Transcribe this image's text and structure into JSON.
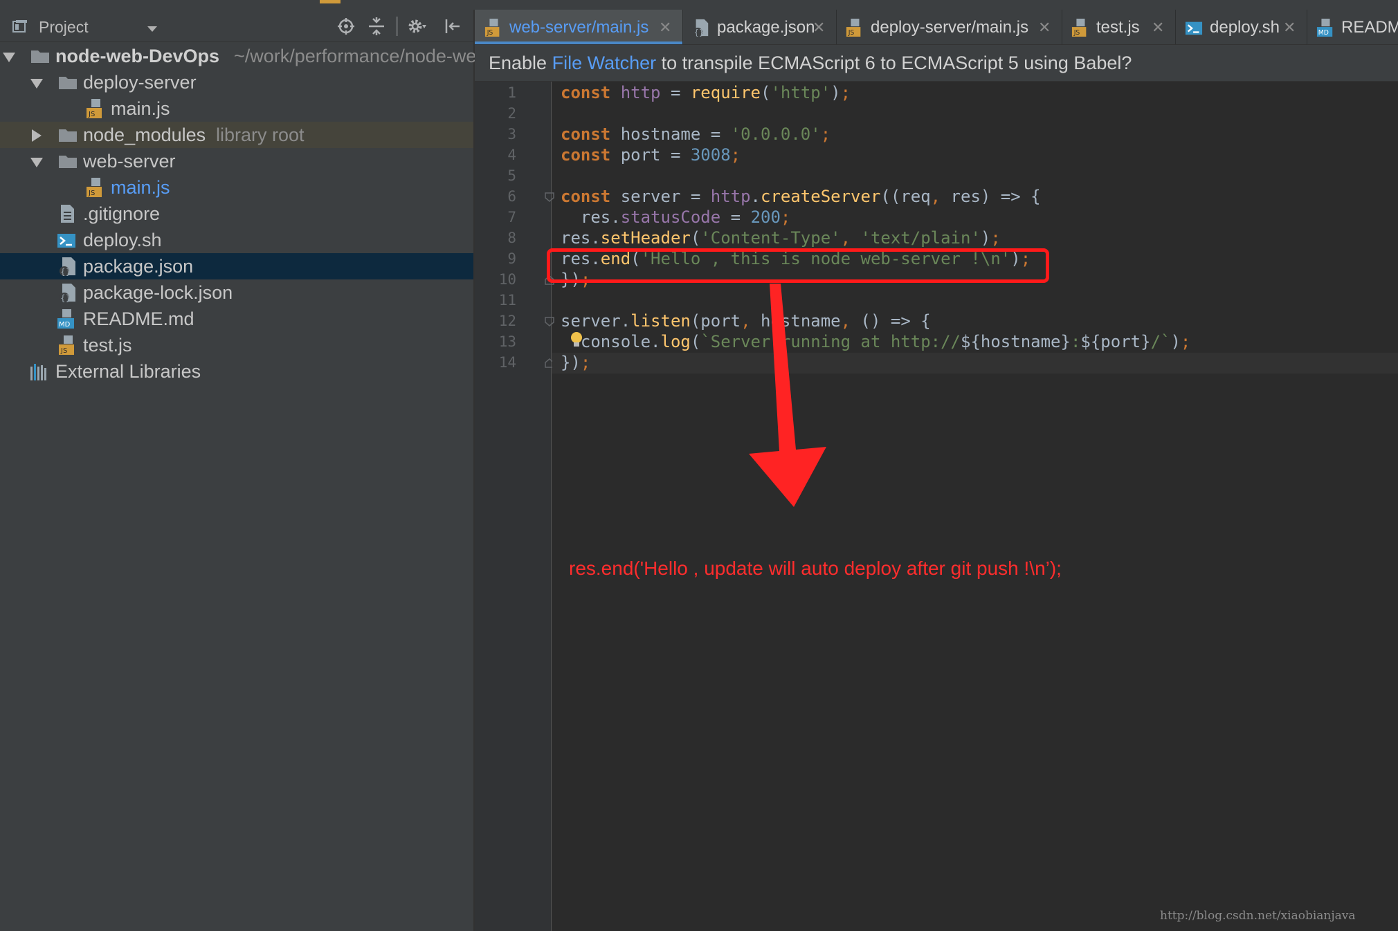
{
  "colors": {
    "editor_bg": "#2b2b2b",
    "panel_bg": "#3c3f41",
    "keyword": "#cc7832",
    "function": "#ffc66d",
    "string": "#6a8759",
    "number": "#6897bb",
    "property": "#9876aa",
    "link": "#589df6",
    "annotation": "#ff2d2d",
    "selection": "#0d293e"
  },
  "project_panel": {
    "title": "Project",
    "toolbar_icons": [
      "locate-icon",
      "collapse-all-icon",
      "gear-icon",
      "hide-panel-icon"
    ],
    "tree": [
      {
        "label": "node-web-DevOps",
        "path": "~/work/performance/node-web-DevOps",
        "type": "folder",
        "expanded": true,
        "bold": true
      },
      {
        "label": "deploy-server",
        "type": "folder",
        "expanded": true
      },
      {
        "label": "main.js",
        "type": "js"
      },
      {
        "label": "node_modules",
        "note": "library root",
        "type": "folder",
        "expanded": false
      },
      {
        "label": "web-server",
        "type": "folder",
        "expanded": true
      },
      {
        "label": "main.js",
        "type": "js",
        "active": true
      },
      {
        "label": ".gitignore",
        "type": "text"
      },
      {
        "label": "deploy.sh",
        "type": "shell"
      },
      {
        "label": "package.json",
        "type": "json",
        "selected": true
      },
      {
        "label": "package-lock.json",
        "type": "json"
      },
      {
        "label": "README.md",
        "type": "md"
      },
      {
        "label": "test.js",
        "type": "js"
      },
      {
        "label": "External Libraries",
        "type": "libraries"
      }
    ]
  },
  "tabs": [
    {
      "label": "web-server/main.js",
      "icon": "js-file-icon",
      "active": true
    },
    {
      "label": "package.json",
      "icon": "json-file-icon"
    },
    {
      "label": "deploy-server/main.js",
      "icon": "js-file-icon"
    },
    {
      "label": "test.js",
      "icon": "js-file-icon"
    },
    {
      "label": "deploy.sh",
      "icon": "shell-file-icon"
    },
    {
      "label": "README.md",
      "icon": "md-file-icon"
    }
  ],
  "notification": {
    "prefix": "Enable ",
    "link": "File Watcher",
    "suffix": " to transpile ECMAScript 6 to ECMAScript 5 using Babel?"
  },
  "editor": {
    "current_line": 14,
    "lines": [
      [
        [
          "kw",
          "const "
        ],
        [
          "prop",
          "http"
        ],
        [
          "plain",
          " = "
        ],
        [
          "fn",
          "require"
        ],
        [
          "plain",
          "("
        ],
        [
          "str",
          "'http'"
        ],
        [
          "plain",
          ")"
        ],
        [
          "punc",
          ";"
        ]
      ],
      [],
      [
        [
          "kw",
          "const "
        ],
        [
          "plain",
          "hostname = "
        ],
        [
          "str",
          "'0.0.0.0'"
        ],
        [
          "punc",
          ";"
        ]
      ],
      [
        [
          "kw",
          "const "
        ],
        [
          "plain",
          "port = "
        ],
        [
          "num",
          "3008"
        ],
        [
          "punc",
          ";"
        ]
      ],
      [],
      [
        [
          "kw",
          "const "
        ],
        [
          "plain",
          "server = "
        ],
        [
          "prop",
          "http"
        ],
        [
          "plain",
          "."
        ],
        [
          "fn",
          "createServer"
        ],
        [
          "plain",
          "((req"
        ],
        [
          "punc",
          ", "
        ],
        [
          "plain",
          "res) => {"
        ]
      ],
      [
        [
          "plain",
          "  res."
        ],
        [
          "prop",
          "statusCode"
        ],
        [
          "plain",
          " = "
        ],
        [
          "num",
          "200"
        ],
        [
          "punc",
          ";"
        ]
      ],
      [
        [
          "plain",
          "res."
        ],
        [
          "fn",
          "setHeader"
        ],
        [
          "plain",
          "("
        ],
        [
          "str",
          "'Content-Type'"
        ],
        [
          "punc",
          ", "
        ],
        [
          "str",
          "'text/plain'"
        ],
        [
          "plain",
          ")"
        ],
        [
          "punc",
          ";"
        ]
      ],
      [
        [
          "plain",
          "res."
        ],
        [
          "fn",
          "end"
        ],
        [
          "plain",
          "("
        ],
        [
          "str",
          "'Hello , this is node web-server !\\n'"
        ],
        [
          "plain",
          ")"
        ],
        [
          "punc",
          ";"
        ]
      ],
      [
        [
          "plain",
          "})"
        ],
        [
          "punc",
          ";"
        ]
      ],
      [],
      [
        [
          "plain",
          "server."
        ],
        [
          "fn",
          "listen"
        ],
        [
          "plain",
          "(port"
        ],
        [
          "punc",
          ", "
        ],
        [
          "plain",
          "hostname"
        ],
        [
          "punc",
          ", "
        ],
        [
          "plain",
          "() => {"
        ]
      ],
      [
        [
          "plain",
          "  console."
        ],
        [
          "fn",
          "log"
        ],
        [
          "plain",
          "("
        ],
        [
          "str",
          "`Server running at http://"
        ],
        [
          "plain",
          "${hostname}"
        ],
        [
          "str",
          ":"
        ],
        [
          "plain",
          "${port}"
        ],
        [
          "str",
          "/`"
        ],
        [
          "plain",
          ")"
        ],
        [
          "punc",
          ";"
        ]
      ],
      [
        [
          "plain",
          "})"
        ],
        [
          "punc",
          ";"
        ]
      ]
    ]
  },
  "annotation": {
    "text": "res.end('Hello ,  update will auto deploy after git push !\\n’);"
  },
  "watermark": "http://blog.csdn.net/xiaobianjava"
}
